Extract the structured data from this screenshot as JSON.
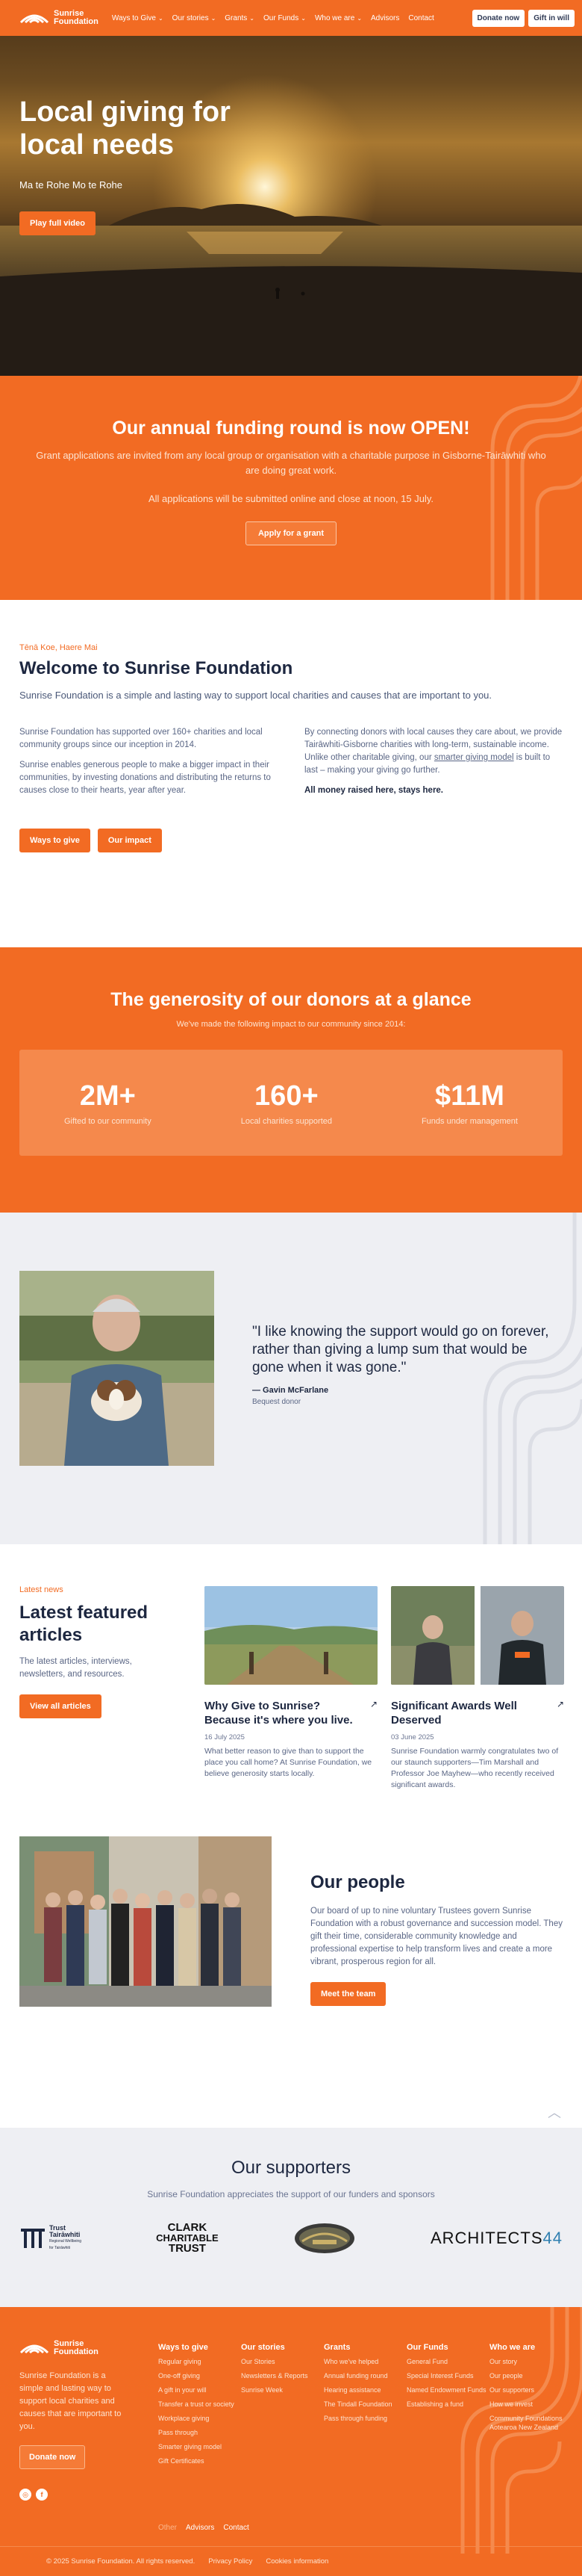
{
  "brand": {
    "line1": "Sunrise",
    "line2": "Foundation",
    "accent": "#f26b23",
    "navy": "#1d2740"
  },
  "nav": {
    "items": [
      {
        "label": "Ways to Give",
        "dropdown": true
      },
      {
        "label": "Our stories",
        "dropdown": true
      },
      {
        "label": "Grants",
        "dropdown": true
      },
      {
        "label": "Our Funds",
        "dropdown": true
      },
      {
        "label": "Who we are",
        "dropdown": true
      },
      {
        "label": "Advisors",
        "dropdown": false
      },
      {
        "label": "Contact",
        "dropdown": false
      }
    ],
    "donate_label": "Donate now",
    "gift_label": "Gift in will"
  },
  "hero": {
    "title": "Local giving for local needs",
    "subtitle": "Ma te Rohe Mo te Rohe",
    "button": "Play full video"
  },
  "funding": {
    "title": "Our annual funding round is now OPEN!",
    "text1": "Grant applications are invited from any local group or organisation with a charitable purpose in Gisborne-Tairāwhiti who are doing great work.",
    "text2": "All applications will be submitted online and close at noon, 15 July.",
    "button": "Apply for a grant"
  },
  "welcome": {
    "kicker": "Tēnā Koe, Haere Mai",
    "title": "Welcome to Sunrise Foundation",
    "lead": "Sunrise Foundation is a simple and lasting way to support local charities and causes that are important to you.",
    "left_p1": "Sunrise Foundation has supported over 160+ charities and local community groups since our inception in 2014.",
    "left_p2": "Sunrise enables generous people to make a bigger impact in their communities, by investing donations and distributing the returns to causes close to their hearts, year after year.",
    "right_p1_a": "By connecting donors with local causes they care about, we provide Tairāwhiti-Gisborne charities with long-term, sustainable income. Unlike other charitable giving, our ",
    "right_p1_link": "smarter giving model",
    "right_p1_b": " is built to last – making your giving go further.",
    "right_p2": "All money raised here, stays here.",
    "btn1": "Ways to give",
    "btn2": "Our impact"
  },
  "stats": {
    "title": "The generosity of our donors at a glance",
    "subtitle": "We've made the following impact to our community since 2014:",
    "items": [
      {
        "value": "2M+",
        "label": "Gifted to our community"
      },
      {
        "value": "160+",
        "label": "Local charities supported"
      },
      {
        "value": "$11M",
        "label": "Funds under management"
      }
    ]
  },
  "testimonial": {
    "quote": "\"I like knowing the support would go on forever, rather than giving a lump sum that would be gone when it was gone.\"",
    "author": "— Gavin McFarlane",
    "role": "Bequest donor"
  },
  "articles": {
    "kicker": "Latest news",
    "title": "Latest featured articles",
    "desc": "The latest articles, interviews, newsletters, and resources.",
    "button": "View all articles",
    "cards": [
      {
        "title": "Why Give to Sunrise? Because it's where you live.",
        "date": "16 July 2025",
        "excerpt": "What better reason to give than to support the place you call home? At Sunrise Foundation, we believe generosity starts locally."
      },
      {
        "title": "Significant Awards Well Deserved",
        "date": "03 June 2025",
        "excerpt": "Sunrise Foundation warmly congratulates two of our staunch supporters—Tim Marshall and Professor Joe Mayhew—who recently received significant awards."
      }
    ]
  },
  "people": {
    "title": "Our people",
    "text": "Our board of up to nine voluntary Trustees govern Sunrise Foundation with a robust governance and succession model. They gift their time, considerable community knowledge and professional expertise to help transform lives and create a more vibrant, prosperous region for all.",
    "button": "Meet the team"
  },
  "supporters": {
    "title": "Our supporters",
    "subtitle": "Sunrise Foundation appreciates the support of our funders and sponsors",
    "logos": {
      "trust_line1": "Trust",
      "trust_line2": "Tairāwhiti",
      "trust_line3": "Regional Wellbeing",
      "trust_line4": "for Tairāwhiti",
      "clark_line1": "CLARK",
      "clark_line2": "CHARITABLE",
      "clark_line3": "TRUST",
      "architects": "ARCHITECTS",
      "architects_num": "44"
    }
  },
  "footer": {
    "desc": "Sunrise Foundation is a simple and lasting way to support local charities and causes that are important to you.",
    "donate": "Donate now",
    "columns": [
      {
        "title": "Ways to give",
        "links": [
          "Regular giving",
          "One-off giving",
          "A gift in your will",
          "Transfer a trust or society",
          "Workplace giving",
          "Pass through",
          "Smarter giving model",
          "Gift Certificates"
        ]
      },
      {
        "title": "Our stories",
        "links": [
          "Our Stories",
          "Newsletters & Reports",
          "Sunrise Week"
        ]
      },
      {
        "title": "Grants",
        "links": [
          "Who we've helped",
          "Annual funding round",
          "Hearing assistance",
          "The Tindall Foundation",
          "Pass through funding"
        ]
      },
      {
        "title": "Our Funds",
        "links": [
          "General Fund",
          "Special Interest Funds",
          "Named Endowment Funds",
          "Establishing a fund"
        ]
      },
      {
        "title": "Who we are",
        "links": [
          "Our story",
          "Our people",
          "Our supporters",
          "How we invest",
          "Community Foundations Aotearoa New Zealand"
        ]
      }
    ],
    "other_label": "Other",
    "other_links": [
      "Advisors",
      "Contact"
    ],
    "copyright": "© 2025 Sunrise Foundation. All rights reserved.",
    "privacy": "Privacy Policy",
    "cookies": "Cookies information"
  }
}
